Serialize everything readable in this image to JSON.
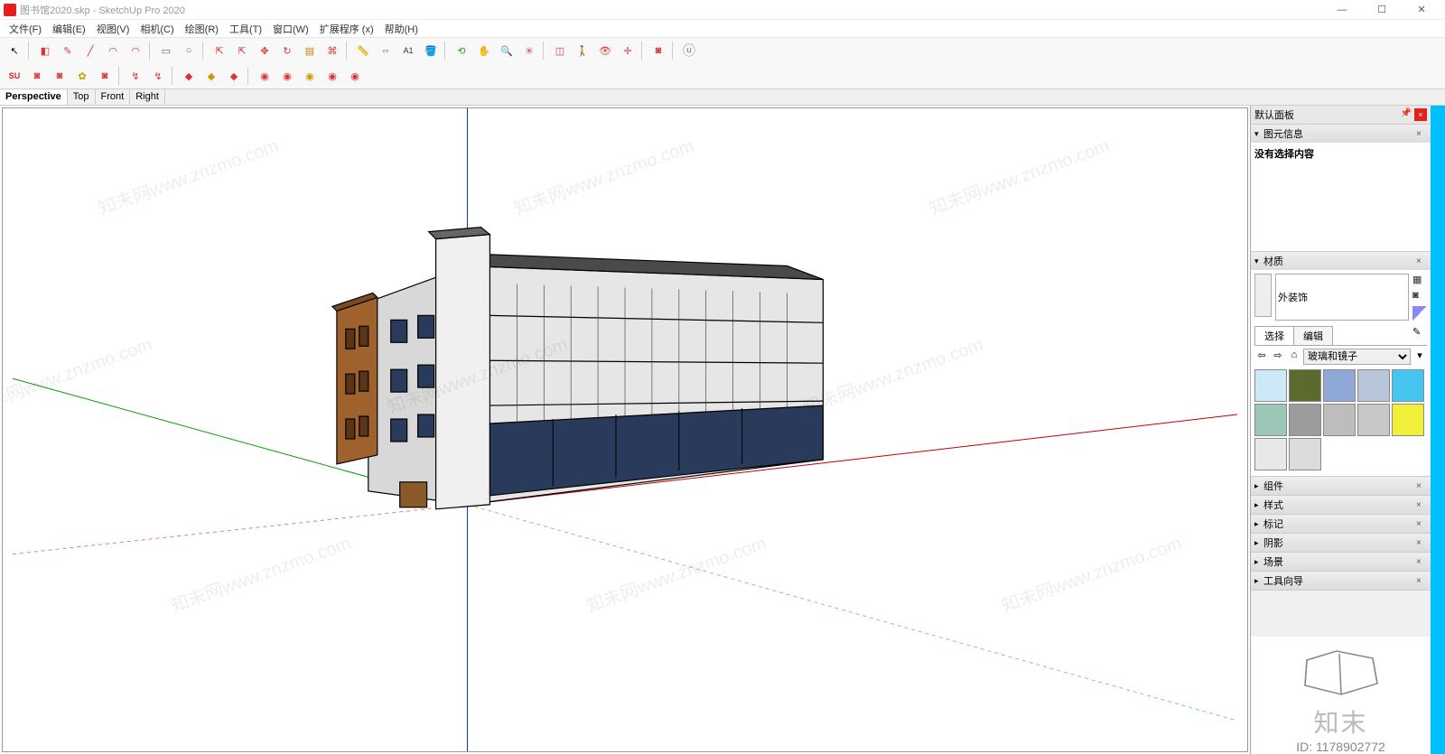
{
  "window": {
    "title": "图书馆2020.skp - SketchUp Pro 2020",
    "min": "—",
    "max": "☐",
    "close": "✕"
  },
  "menu": [
    {
      "label": "文件(F)"
    },
    {
      "label": "编辑(E)"
    },
    {
      "label": "视图(V)"
    },
    {
      "label": "相机(C)"
    },
    {
      "label": "绘图(R)"
    },
    {
      "label": "工具(T)"
    },
    {
      "label": "窗口(W)"
    },
    {
      "label": "扩展程序 (x)"
    },
    {
      "label": "帮助(H)"
    }
  ],
  "viewtabs": [
    {
      "label": "Perspective",
      "active": true
    },
    {
      "label": "Top"
    },
    {
      "label": "Front"
    },
    {
      "label": "Right"
    }
  ],
  "tray": {
    "title": "默认面板",
    "entity_info": {
      "header": "图元信息",
      "content": "没有选择内容"
    },
    "materials": {
      "header": "材质",
      "name_value": "外装饰",
      "tabs": {
        "select": "选择",
        "edit": "编辑"
      },
      "library": "玻璃和镜子",
      "swatch_colors": [
        "#cde8f7",
        "#5a6b2d",
        "#8fa8d6",
        "#b9c6d9",
        "#47c4f0",
        "#9cc6b6",
        "#9c9c9c",
        "#bdbdbd",
        "#c8c8c8",
        "#f2ef3a",
        "#e8e8e8",
        "#dcdcdc"
      ]
    },
    "collapsed": [
      {
        "label": "组件"
      },
      {
        "label": "样式"
      },
      {
        "label": "标记"
      },
      {
        "label": "阴影"
      },
      {
        "label": "场景"
      },
      {
        "label": "工具向导"
      }
    ]
  },
  "corner": {
    "brand": "知末",
    "id": "ID: 1178902772"
  },
  "watermark": "知未网www.znzmo.com",
  "icons": {
    "select": "↖",
    "eraser": "◧",
    "pencil": "✎",
    "line": "╱",
    "arc": "◠",
    "rect": "▭",
    "circle": "○",
    "push": "⇱",
    "move": "✥",
    "rotate": "↻",
    "scale": "▤",
    "offset": "⌘",
    "tape": "📏",
    "text": "A1",
    "paint": "🪣",
    "orbit": "⟲",
    "pan": "✋",
    "zoom": "🔍",
    "zoomext": "✳",
    "section": "◫",
    "walk": "🚶",
    "look": "👁",
    "axes": "✛",
    "dim": "⇔",
    "user": "ⓤ",
    "house": "⌂",
    "arrow_l": "⇦",
    "arrow_r": "⇨",
    "sample": "✎",
    "bucket": "🪣",
    "cube": "◙",
    "pin": "📌",
    "x": "×",
    "tri_r": "▸",
    "tri_d": "▾",
    "su": "SU"
  }
}
